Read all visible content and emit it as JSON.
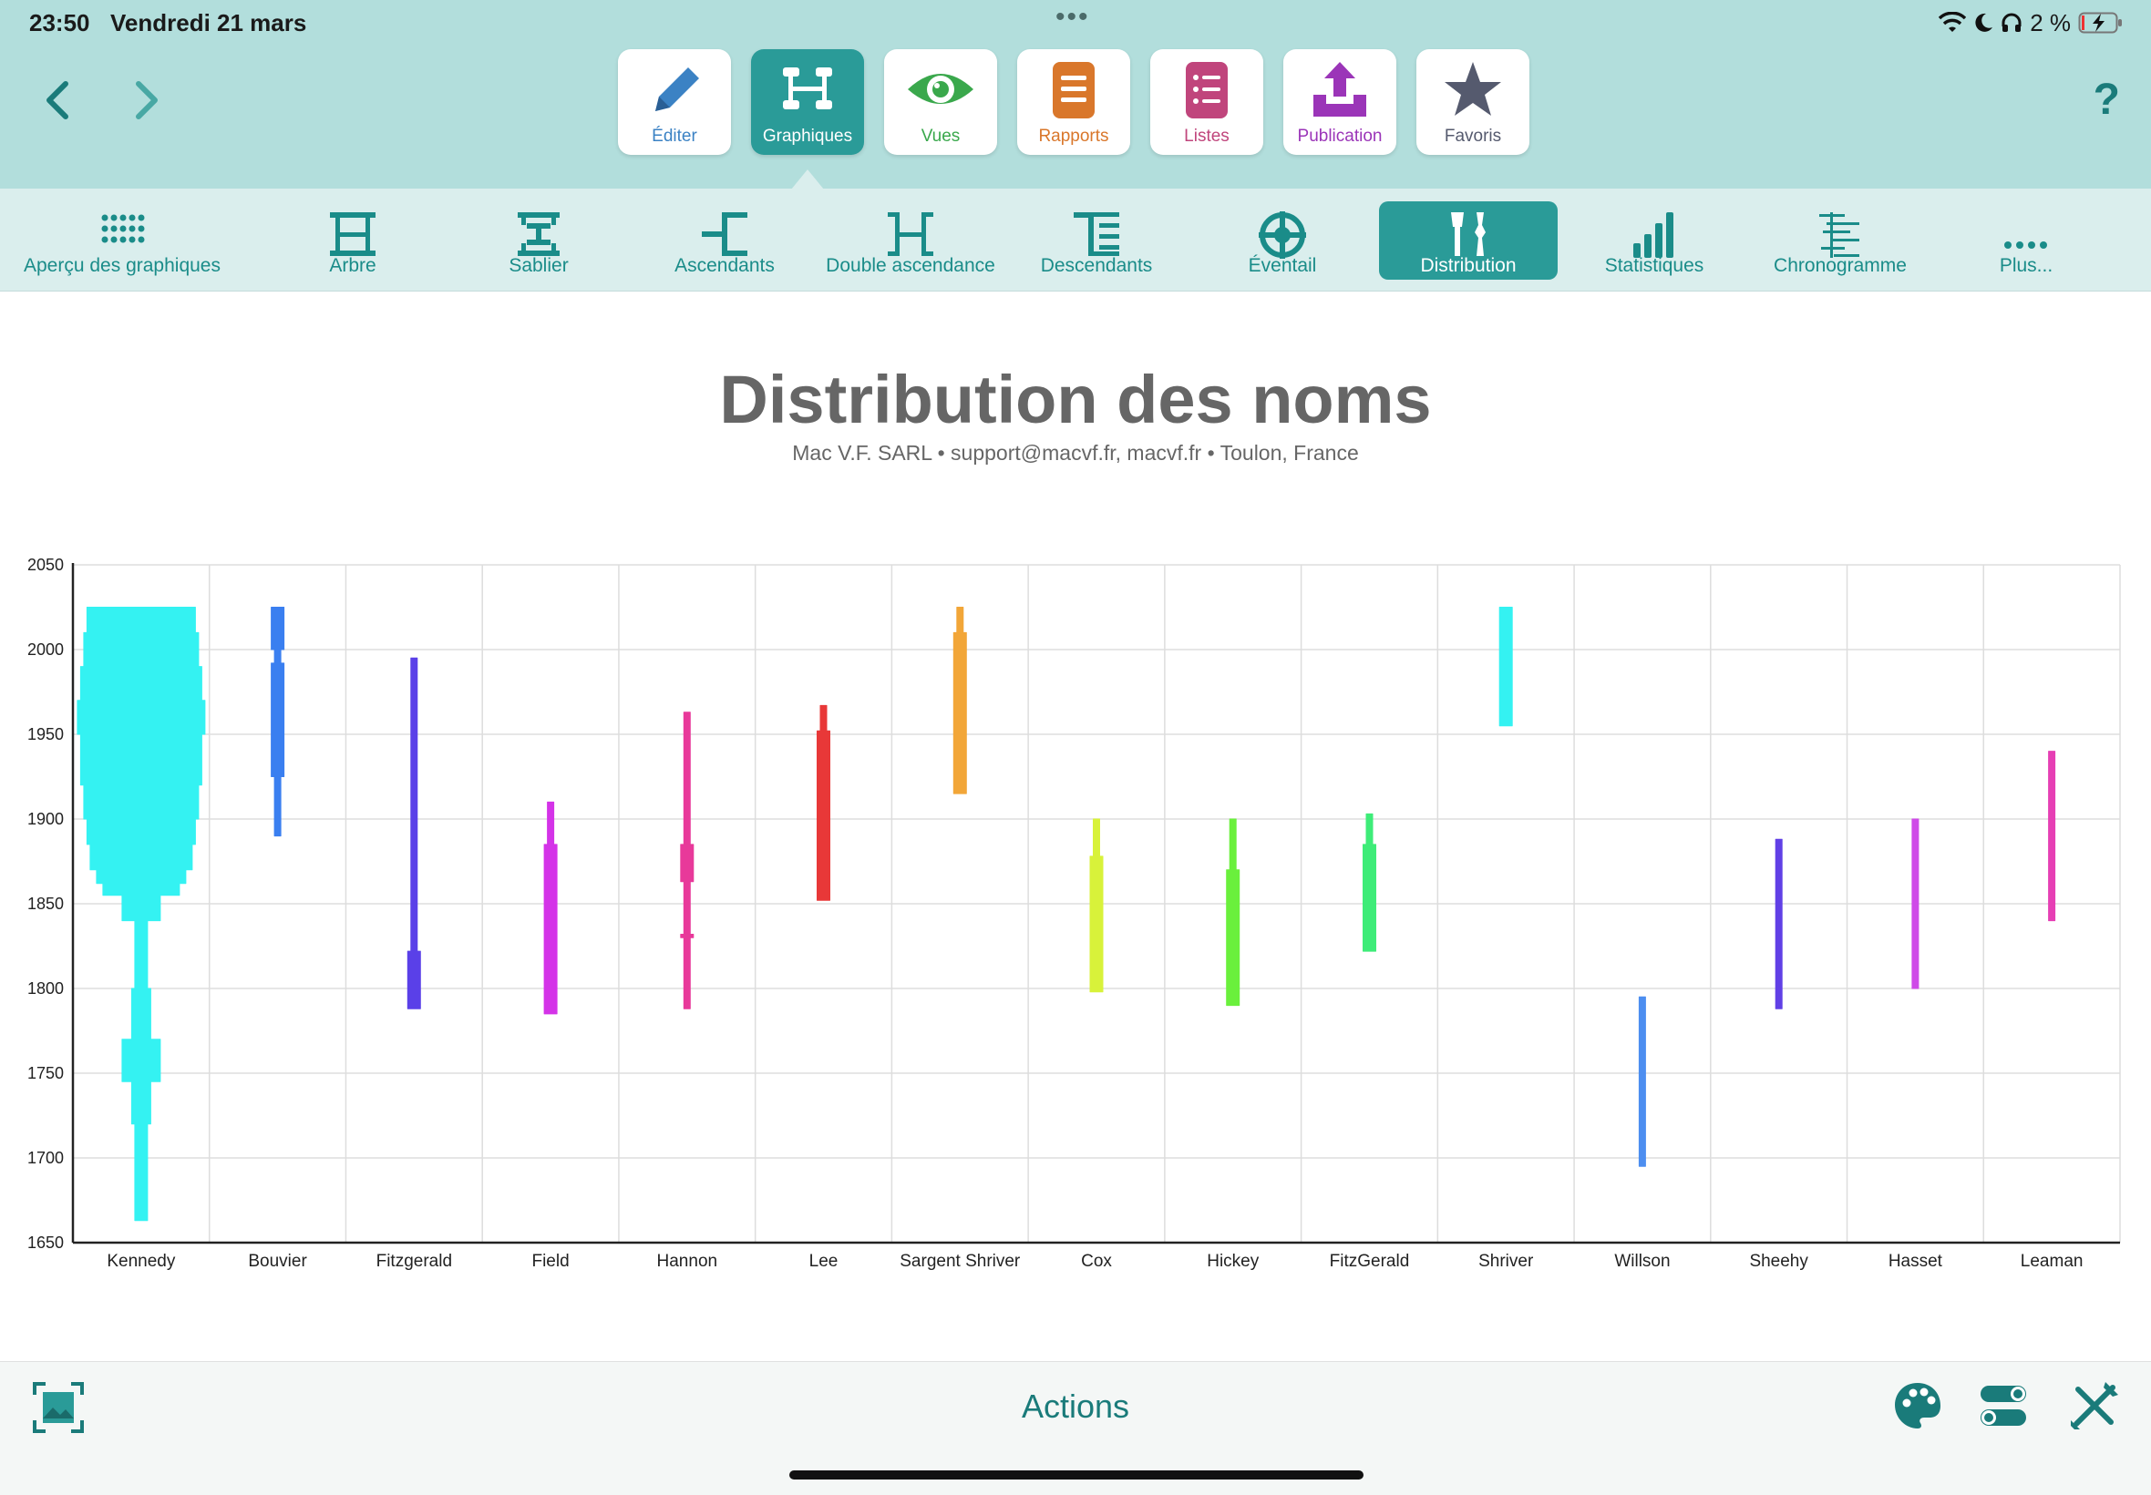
{
  "status": {
    "time": "23:50",
    "date": "Vendredi 21 mars",
    "battery": "2 %"
  },
  "nav": {
    "back": "back",
    "forward": "forward",
    "help": "?"
  },
  "apps": [
    {
      "label": "Éditer",
      "icon": "pencil-icon",
      "color": "#3b82c4",
      "active": false
    },
    {
      "label": "Graphiques",
      "icon": "chart-tree-icon",
      "color": "#ffffff",
      "active": true
    },
    {
      "label": "Vues",
      "icon": "eye-icon",
      "color": "#3aa84c",
      "active": false
    },
    {
      "label": "Rapports",
      "icon": "report-icon",
      "color": "#d9772b",
      "active": false
    },
    {
      "label": "Listes",
      "icon": "list-icon",
      "color": "#c0457c",
      "active": false
    },
    {
      "label": "Publication",
      "icon": "upload-icon",
      "color": "#9b35b8",
      "active": false
    },
    {
      "label": "Favoris",
      "icon": "star-icon",
      "color": "#555a6e",
      "active": false
    }
  ],
  "tools": [
    {
      "label": "Aperçu des graphiques",
      "icon": "grid-dots-icon",
      "active": false
    },
    {
      "label": "Arbre",
      "icon": "tree-icon",
      "active": false
    },
    {
      "label": "Sablier",
      "icon": "hourglass-icon",
      "active": false
    },
    {
      "label": "Ascendants",
      "icon": "ancestors-icon",
      "active": false
    },
    {
      "label": "Double ascendance",
      "icon": "double-ancestry-icon",
      "active": false
    },
    {
      "label": "Descendants",
      "icon": "descendants-icon",
      "active": false
    },
    {
      "label": "Éventail",
      "icon": "fan-icon",
      "active": false
    },
    {
      "label": "Distribution",
      "icon": "distribution-icon",
      "active": true
    },
    {
      "label": "Statistiques",
      "icon": "statistics-icon",
      "active": false
    },
    {
      "label": "Chronogramme",
      "icon": "timeline-icon",
      "active": false
    },
    {
      "label": "Plus...",
      "icon": "more-icon",
      "active": false
    }
  ],
  "colors": {
    "accent": "#2a9b98",
    "topbar": "#b2dedc",
    "toolbar": "#daeeed",
    "text_accent": "#1a8c89"
  },
  "chart_data": {
    "type": "distribution",
    "title": "Distribution des noms",
    "subtitle": "Mac V.F. SARL • support@macvf.fr, macvf.fr • Toulon, France",
    "ylim": [
      1650,
      2050
    ],
    "yticks": [
      2050,
      2000,
      1950,
      1900,
      1850,
      1800,
      1750,
      1700,
      1650
    ],
    "grid": true,
    "categories": [
      "Kennedy",
      "Bouvier",
      "Fitzgerald",
      "Field",
      "Hannon",
      "Lee",
      "Sargent Shriver",
      "Cox",
      "Hickey",
      "FitzGerald",
      "Shriver",
      "Willson",
      "Sheehy",
      "Hasset",
      "Leaman"
    ],
    "series": [
      {
        "color": "#34f2f2",
        "profile": [
          [
            1663,
            1
          ],
          [
            1690,
            2
          ],
          [
            1700,
            2
          ],
          [
            1720,
            2
          ],
          [
            1745,
            3
          ],
          [
            1770,
            6
          ],
          [
            1790,
            3
          ],
          [
            1800,
            3
          ],
          [
            1820,
            2
          ],
          [
            1840,
            2
          ],
          [
            1855,
            6
          ],
          [
            1862,
            12
          ],
          [
            1870,
            14
          ],
          [
            1885,
            16
          ],
          [
            1900,
            17
          ],
          [
            1920,
            18
          ],
          [
            1950,
            19
          ],
          [
            1970,
            20
          ],
          [
            1990,
            19
          ],
          [
            2010,
            18
          ],
          [
            2025,
            17
          ]
        ]
      },
      {
        "color": "#3a7ff0",
        "profile": [
          [
            1890,
            1
          ],
          [
            1925,
            1
          ],
          [
            1935,
            2
          ],
          [
            1992,
            2
          ],
          [
            2000,
            1
          ],
          [
            2025,
            2
          ]
        ]
      },
      {
        "color": "#5a40e8",
        "profile": [
          [
            1788,
            2
          ],
          [
            1822,
            2
          ],
          [
            1823,
            1
          ],
          [
            1883,
            1
          ],
          [
            1890,
            1
          ],
          [
            1995,
            1
          ]
        ]
      },
      {
        "color": "#d433e8",
        "profile": [
          [
            1785,
            1
          ],
          [
            1812,
            2
          ],
          [
            1885,
            2
          ],
          [
            1910,
            1
          ]
        ]
      },
      {
        "color": "#e8399a",
        "profile": [
          [
            1788,
            1
          ],
          [
            1830,
            1
          ],
          [
            1832,
            2
          ],
          [
            1835,
            1
          ],
          [
            1863,
            1
          ],
          [
            1866,
            2
          ],
          [
            1885,
            2
          ],
          [
            1887,
            1
          ],
          [
            1963,
            1
          ]
        ]
      },
      {
        "color": "#e83838",
        "profile": [
          [
            1852,
            1
          ],
          [
            1877,
            2
          ],
          [
            1952,
            2
          ],
          [
            1967,
            1
          ]
        ]
      },
      {
        "color": "#f2a638",
        "profile": [
          [
            1915,
            1
          ],
          [
            1953,
            2
          ],
          [
            2010,
            2
          ],
          [
            2025,
            1
          ]
        ]
      },
      {
        "color": "#d8f23a",
        "profile": [
          [
            1798,
            1
          ],
          [
            1835,
            2
          ],
          [
            1878,
            2
          ],
          [
            1900,
            1
          ]
        ]
      },
      {
        "color": "#6af03c",
        "profile": [
          [
            1790,
            1
          ],
          [
            1836,
            2
          ],
          [
            1870,
            2
          ],
          [
            1900,
            1
          ]
        ]
      },
      {
        "color": "#3eec78",
        "profile": [
          [
            1822,
            1
          ],
          [
            1833,
            2
          ],
          [
            1885,
            2
          ],
          [
            1903,
            1
          ]
        ]
      },
      {
        "color": "#34f2f2",
        "profile": [
          [
            1955,
            1
          ],
          [
            1965,
            2
          ],
          [
            2025,
            2
          ]
        ]
      },
      {
        "color": "#4d8ef0",
        "profile": [
          [
            1695,
            1
          ],
          [
            1795,
            1
          ]
        ]
      },
      {
        "color": "#6140e6",
        "profile": [
          [
            1788,
            1
          ],
          [
            1888,
            1
          ]
        ]
      },
      {
        "color": "#cf4ae8",
        "profile": [
          [
            1800,
            1
          ],
          [
            1900,
            1
          ]
        ]
      },
      {
        "color": "#e63fb4",
        "profile": [
          [
            1840,
            1
          ],
          [
            1940,
            1
          ]
        ]
      }
    ]
  },
  "bottom": {
    "actions": "Actions"
  }
}
